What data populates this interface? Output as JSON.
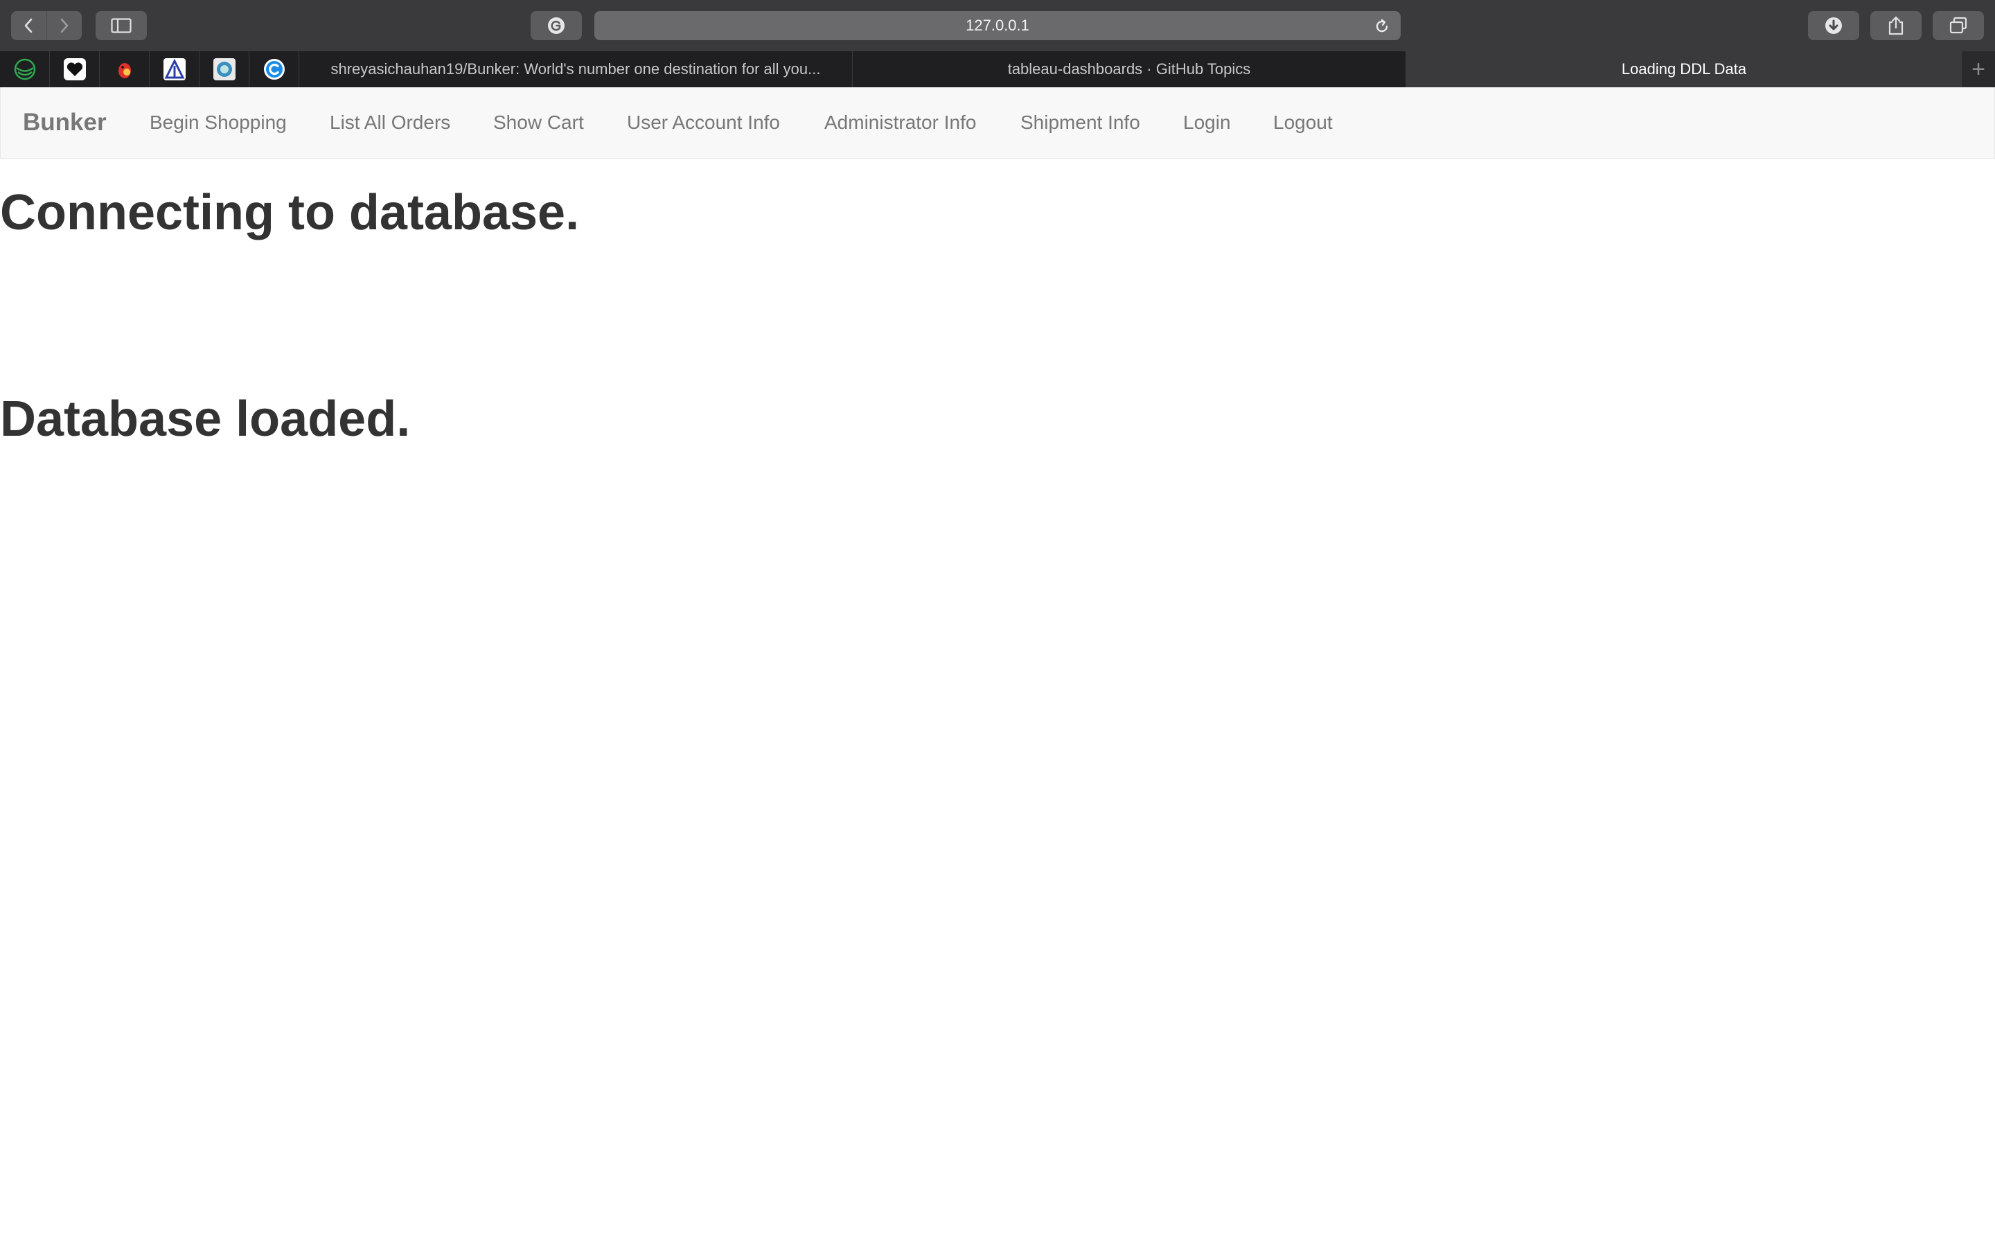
{
  "browser": {
    "url": "127.0.0.1",
    "pinned_tabs": [
      "green-globe-icon",
      "black-heart-icon",
      "red-bird-icon",
      "blue-triangle-icon",
      "teal-circle-icon",
      "blue-c-icon"
    ],
    "tabs": [
      {
        "title": "shreyasichauhan19/Bunker: World's number one destination for all you...",
        "active": false
      },
      {
        "title": "tableau-dashboards · GitHub Topics",
        "active": false
      },
      {
        "title": "Loading DDL Data",
        "active": true
      }
    ],
    "new_tab": "+"
  },
  "navbar": {
    "brand": "Bunker",
    "links": [
      "Begin Shopping",
      "List All Orders",
      "Show Cart",
      "User Account Info",
      "Administrator Info",
      "Shipment Info",
      "Login",
      "Logout"
    ]
  },
  "content": {
    "heading1": "Connecting to database.",
    "heading2": "Database loaded."
  },
  "colors": {
    "toolbar_bg": "#3a3a3c",
    "tabbar_bg": "#1f1f21",
    "navbar_bg": "#f8f8f8",
    "nav_text": "#777777",
    "heading_text": "#333333"
  }
}
